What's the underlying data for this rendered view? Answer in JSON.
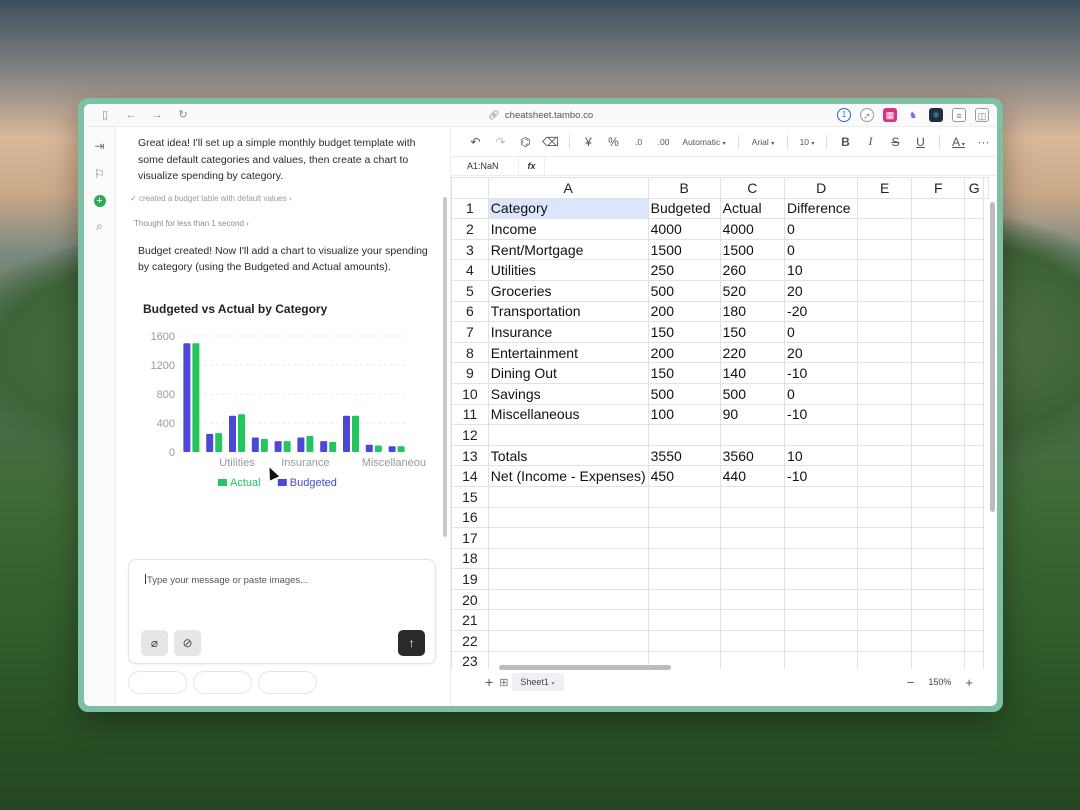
{
  "browser": {
    "url": "cheatsheet.tambo.co",
    "nav_icons": [
      "sidebar-icon",
      "back-icon",
      "forward-icon",
      "reload-icon"
    ],
    "extensions": [
      "1password-icon",
      "compass-icon",
      "grid-extension-icon",
      "tambo-extension-icon",
      "react-extension-icon",
      "reader-icon",
      "split-view-icon"
    ]
  },
  "chat": {
    "message1": "Great idea! I'll set up a simple monthly budget template with some default categories and values, then create a chart to visualize spending by category.",
    "tool_call": "created a budget table with default values",
    "thought": "Thought for less than 1 second",
    "message2": "Budget created! Now I'll add a chart to visualize your spending by category (using the Budgeted and Actual amounts).",
    "composer_placeholder": "Type your message or paste images..."
  },
  "chart_data": {
    "type": "bar",
    "title": "Budgeted vs Actual by Category",
    "categories": [
      "Income",
      "Rent/Mortgage",
      "Utilities",
      "Groceries",
      "Transportation",
      "Insurance",
      "Entertainment",
      "Dining Out",
      "Savings",
      "Miscellaneous"
    ],
    "visible_x_ticks": [
      "Utilities",
      "Insurance",
      "Miscellaneous"
    ],
    "series": [
      {
        "name": "Budgeted",
        "color": "#4b48d6",
        "values": [
          1500,
          250,
          500,
          200,
          150,
          200,
          150,
          500,
          100,
          80
        ]
      },
      {
        "name": "Actual",
        "color": "#22c55e",
        "values": [
          1500,
          260,
          520,
          180,
          150,
          220,
          140,
          500,
          90,
          80
        ]
      }
    ],
    "ylim": [
      0,
      1600
    ],
    "yticks": [
      "0",
      "400",
      "800",
      "1200",
      "1600"
    ],
    "grid": true,
    "legend": [
      {
        "label": "Actual",
        "color": "#22c55e"
      },
      {
        "label": "Budgeted",
        "color": "#4b48d6"
      }
    ],
    "legend_position": "bottom"
  },
  "toolbar": {
    "currency_symbol": "¥",
    "percent_symbol": "%",
    "decrease_decimal": ".0",
    "increase_decimal": ".00",
    "number_format": "Automatic",
    "font": "Arial",
    "font_size": "10",
    "bold": "B",
    "italic": "I",
    "strike": "S",
    "underline": "U",
    "text_color": "A"
  },
  "formula": {
    "cell_ref": "A1:NaN",
    "fx": "fx"
  },
  "spreadsheet": {
    "columns": [
      "A",
      "B",
      "C",
      "D",
      "E",
      "F",
      "G"
    ],
    "rows": [
      [
        "1",
        "Category",
        "Budgeted",
        "Actual",
        "Difference",
        "",
        "",
        ""
      ],
      [
        "2",
        "Income",
        "4000",
        "4000",
        "0",
        "",
        "",
        ""
      ],
      [
        "3",
        "Rent/Mortgage",
        "1500",
        "1500",
        "0",
        "",
        "",
        ""
      ],
      [
        "4",
        "Utilities",
        "250",
        "260",
        "10",
        "",
        "",
        ""
      ],
      [
        "5",
        "Groceries",
        "500",
        "520",
        "20",
        "",
        "",
        ""
      ],
      [
        "6",
        "Transportation",
        "200",
        "180",
        "-20",
        "",
        "",
        ""
      ],
      [
        "7",
        "Insurance",
        "150",
        "150",
        "0",
        "",
        "",
        ""
      ],
      [
        "8",
        "Entertainment",
        "200",
        "220",
        "20",
        "",
        "",
        ""
      ],
      [
        "9",
        "Dining Out",
        "150",
        "140",
        "-10",
        "",
        "",
        ""
      ],
      [
        "10",
        "Savings",
        "500",
        "500",
        "0",
        "",
        "",
        ""
      ],
      [
        "11",
        "Miscellaneous",
        "100",
        "90",
        "-10",
        "",
        "",
        ""
      ],
      [
        "12",
        "",
        "",
        "",
        "",
        "",
        "",
        ""
      ],
      [
        "13",
        "Totals",
        "3550",
        "3560",
        "10",
        "",
        "",
        ""
      ],
      [
        "14",
        "Net (Income - Expenses)",
        "450",
        "440",
        "-10",
        "",
        "",
        ""
      ],
      [
        "15",
        "",
        "",
        "",
        "",
        "",
        "",
        ""
      ],
      [
        "16",
        "",
        "",
        "",
        "",
        "",
        "",
        ""
      ],
      [
        "17",
        "",
        "",
        "",
        "",
        "",
        "",
        ""
      ],
      [
        "18",
        "",
        "",
        "",
        "",
        "",
        "",
        ""
      ],
      [
        "19",
        "",
        "",
        "",
        "",
        "",
        "",
        ""
      ],
      [
        "20",
        "",
        "",
        "",
        "",
        "",
        "",
        ""
      ],
      [
        "21",
        "",
        "",
        "",
        "",
        "",
        "",
        ""
      ],
      [
        "22",
        "",
        "",
        "",
        "",
        "",
        "",
        ""
      ],
      [
        "23",
        "",
        "",
        "",
        "",
        "",
        "",
        ""
      ]
    ],
    "sheet_tab": "Sheet1",
    "zoom": "150%"
  }
}
